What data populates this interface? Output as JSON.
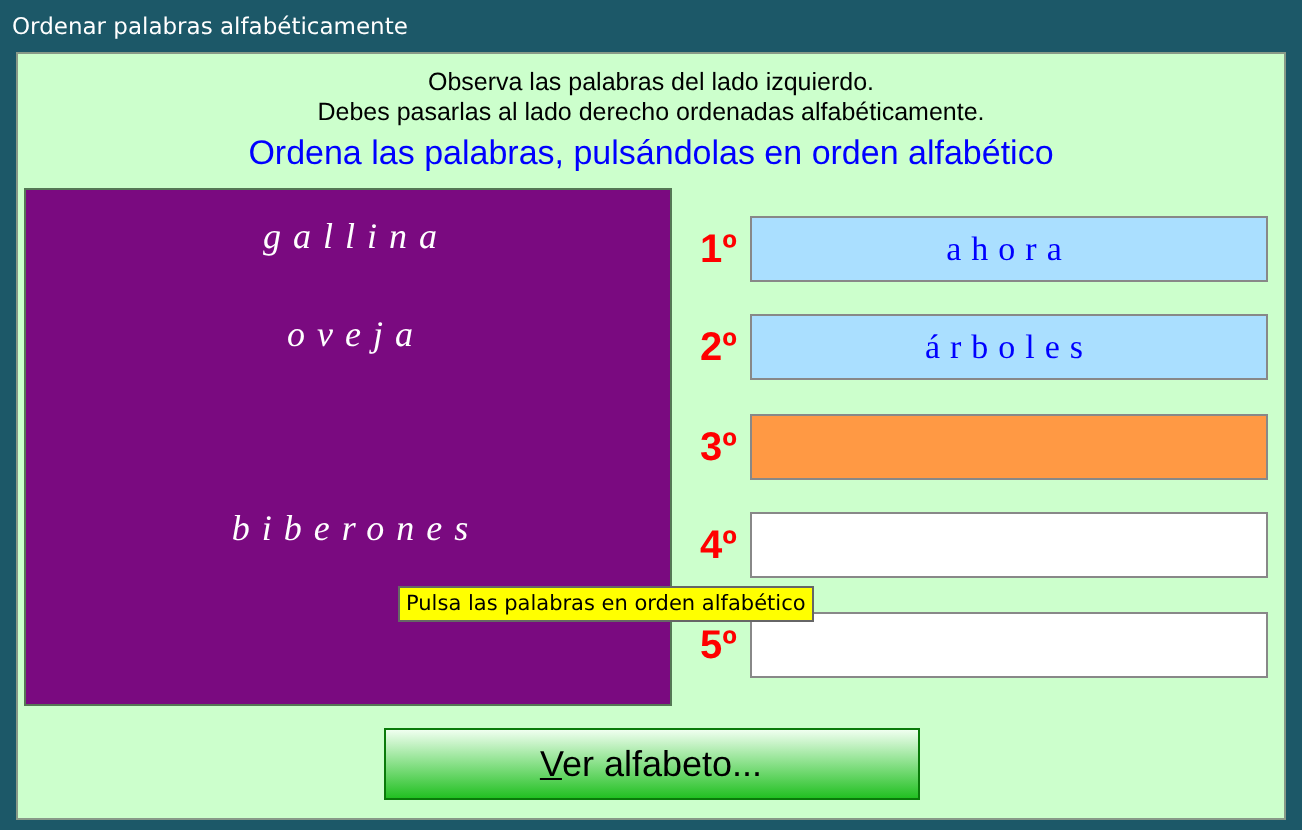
{
  "window": {
    "title": "Ordenar palabras alfabéticamente"
  },
  "instructions": [
    "Observa las palabras del lado izquierdo.",
    "Debes pasarlas al lado derecho ordenadas alfabéticamente."
  ],
  "heading": "Ordena las palabras, pulsándolas en orden alfabético",
  "left_rows": [
    {
      "kind": "word",
      "word": "gallina"
    },
    {
      "kind": "word",
      "word": "oveja"
    },
    {
      "kind": "empty"
    },
    {
      "kind": "word",
      "word": "biberones"
    },
    {
      "kind": "empty"
    }
  ],
  "slots": [
    {
      "ordinal": "1º",
      "kind": "filled",
      "word": "ahora"
    },
    {
      "ordinal": "2º",
      "kind": "filled",
      "word": "árboles"
    },
    {
      "ordinal": "3º",
      "kind": "current"
    },
    {
      "ordinal": "4º",
      "kind": "empty"
    },
    {
      "ordinal": "5º",
      "kind": "empty"
    }
  ],
  "tooltip": "Pulsa las palabras en orden alfabético",
  "button": {
    "accesskey": "V",
    "rest": "er alfabeto..."
  }
}
